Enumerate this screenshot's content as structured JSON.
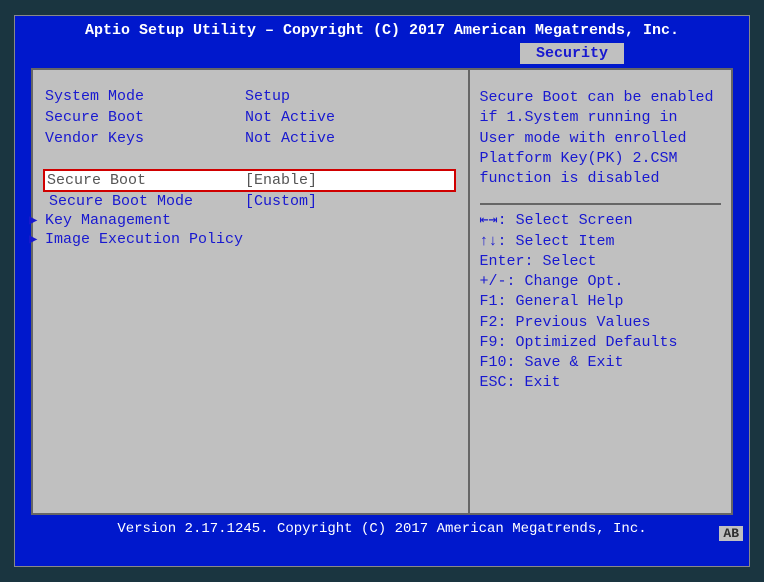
{
  "header": {
    "title": "Aptio Setup Utility – Copyright (C) 2017 American Megatrends, Inc.",
    "active_tab": "Security"
  },
  "info": [
    {
      "label": "System Mode",
      "value": "Setup"
    },
    {
      "label": "Secure Boot",
      "value": "Not Active"
    },
    {
      "label": "Vendor Keys",
      "value": "Not Active"
    }
  ],
  "menu": {
    "secure_boot": {
      "label": "Secure Boot",
      "value": "[Enable]"
    },
    "secure_boot_mode": {
      "label": "Secure Boot Mode",
      "value": "[Custom]"
    },
    "key_management": {
      "label": "Key Management"
    },
    "image_execution_policy": {
      "label": "Image Execution Policy"
    }
  },
  "help": {
    "description": "Secure Boot can be enabled if 1.System running in User mode with enrolled Platform Key(PK) 2.CSM function is disabled",
    "keys": [
      "⇤⇥: Select Screen",
      "↑↓: Select Item",
      "Enter: Select",
      "+/-: Change Opt.",
      "F1: General Help",
      "F2: Previous Values",
      "F9: Optimized Defaults",
      "F10: Save & Exit",
      "ESC: Exit"
    ]
  },
  "footer": {
    "text": "Version 2.17.1245. Copyright (C) 2017 American Megatrends, Inc.",
    "tag": "AB"
  }
}
